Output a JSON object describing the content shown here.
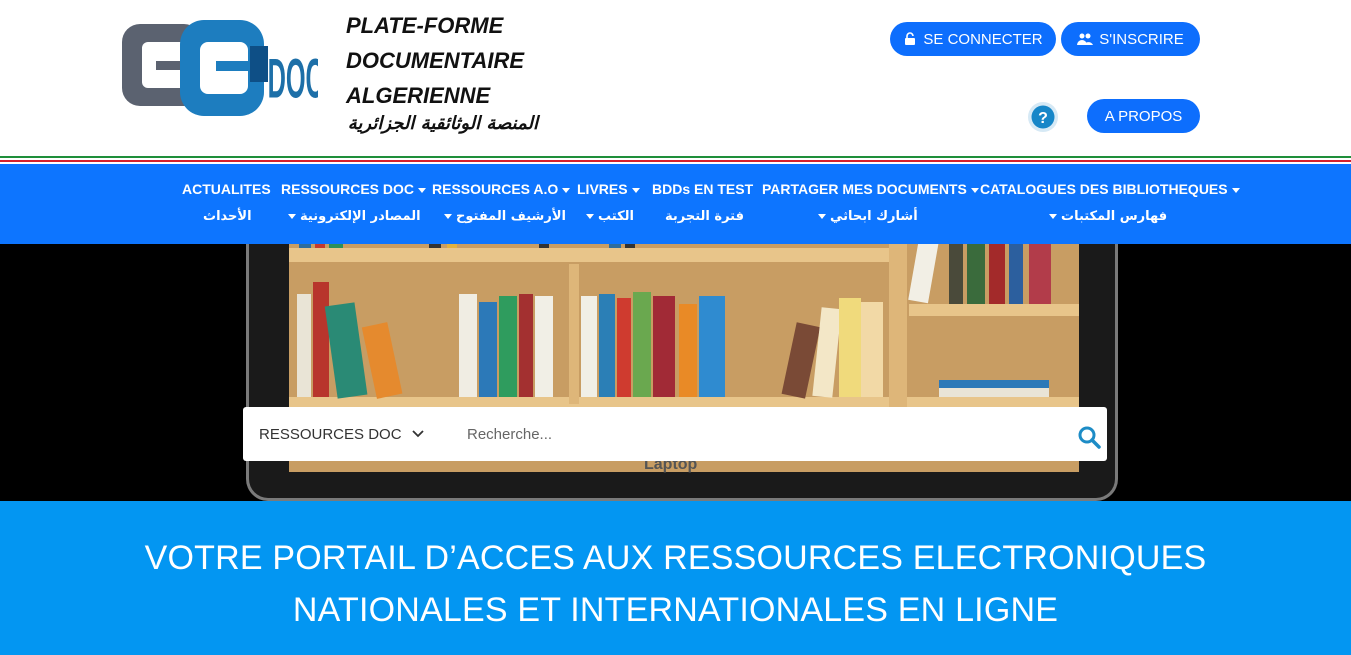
{
  "brand": {
    "title_lines": [
      "PLATE-FORME",
      "DOCUMENTAIRE",
      "ALGERIENNE"
    ],
    "arabic": "المنصة الوثائقية الجزائرية",
    "logo_text": "DOC"
  },
  "header": {
    "login_label": "SE CONNECTER",
    "signup_label": "S'INSCRIRE",
    "about_label": "A PROPOS"
  },
  "nav": {
    "fr": [
      {
        "label": "ACTUALITES",
        "dropdown": false
      },
      {
        "label": "RESSOURCES DOC",
        "dropdown": true
      },
      {
        "label": "RESSOURCES A.O",
        "dropdown": true
      },
      {
        "label": "LIVRES",
        "dropdown": true
      },
      {
        "label": "BDDs EN TEST",
        "dropdown": false
      },
      {
        "label": "PARTAGER MES DOCUMENTS",
        "dropdown": true
      },
      {
        "label": "CATALOGUES DES BIBLIOTHEQUES",
        "dropdown": true
      }
    ],
    "ar": [
      {
        "label": "الأحداث",
        "dropdown": false
      },
      {
        "label": "المصادر الإلكترونية",
        "dropdown": true
      },
      {
        "label": "الأرشيف المفتوح",
        "dropdown": true
      },
      {
        "label": "الكتب",
        "dropdown": true
      },
      {
        "label": "فترة التجربة",
        "dropdown": false
      },
      {
        "label": "أشارك ابحاثي",
        "dropdown": true
      },
      {
        "label": "فهارس المكتبات",
        "dropdown": true
      }
    ]
  },
  "hero": {
    "laptop_brand": "Laptop"
  },
  "search": {
    "selected_scope": "RESSOURCES DOC",
    "placeholder": "Recherche..."
  },
  "banner": {
    "line1": "VOTRE PORTAIL D’ACCES AUX RESSOURCES ELECTRONIQUES",
    "line2": "NATIONALES ET INTERNATIONALES EN LIGNE"
  },
  "colors": {
    "nav_bg": "#0d75ff",
    "button_bg": "#0d6efd",
    "banner_bg": "#0396f2"
  }
}
